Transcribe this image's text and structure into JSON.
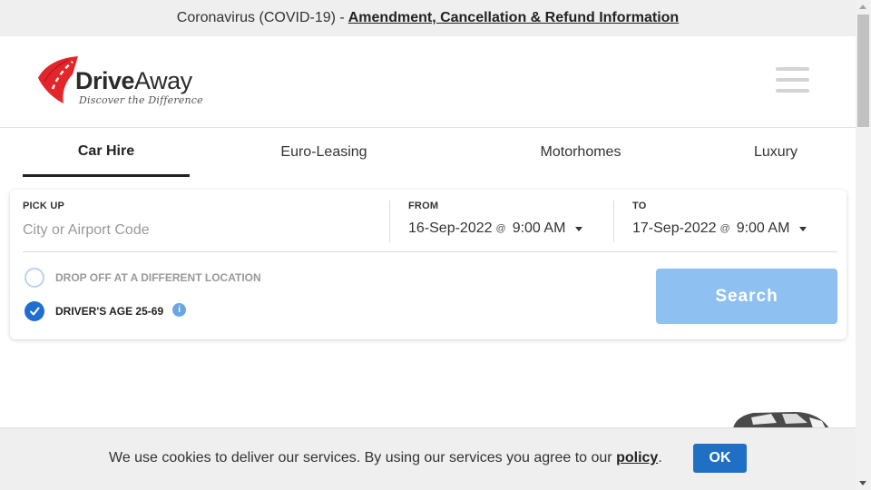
{
  "notice": {
    "text": "Coronavirus (COVID-19) -",
    "link": "Amendment, Cancellation & Refund Information"
  },
  "header": {
    "logo_brand_bold": "Drive",
    "logo_brand_light": "Away",
    "logo_tagline": "Discover the Difference",
    "menu_icon": "hamburger-menu-icon"
  },
  "tabs": [
    {
      "label": "Car Hire",
      "active": true
    },
    {
      "label": "Euro-Leasing",
      "active": false
    },
    {
      "label": "Motorhomes",
      "active": false
    },
    {
      "label": "Luxury",
      "active": false
    }
  ],
  "search": {
    "pickup_label": "PICK UP",
    "pickup_placeholder": "City or Airport Code",
    "from_label": "FROM",
    "from_date": "16-Sep-2022",
    "from_at": "@",
    "from_time": "9:00 AM",
    "to_label": "TO",
    "to_date": "17-Sep-2022",
    "to_at": "@",
    "to_time": "9:00 AM",
    "dropoff_label": "DROP OFF AT A DIFFERENT LOCATION",
    "dropoff_checked": false,
    "age_label": "DRIVER'S AGE 25-69",
    "age_checked": true,
    "info_glyph": "i",
    "search_button": "Search"
  },
  "cookie": {
    "text": "We use cookies to deliver our services. By using our services you agree to our",
    "link": "policy",
    "period": ".",
    "ok_button": "OK"
  },
  "colors": {
    "accent_blue": "#1f6fd1",
    "search_button": "#8ec0f1",
    "logo_red": "#e4262b",
    "notice_bg": "#efefef"
  }
}
